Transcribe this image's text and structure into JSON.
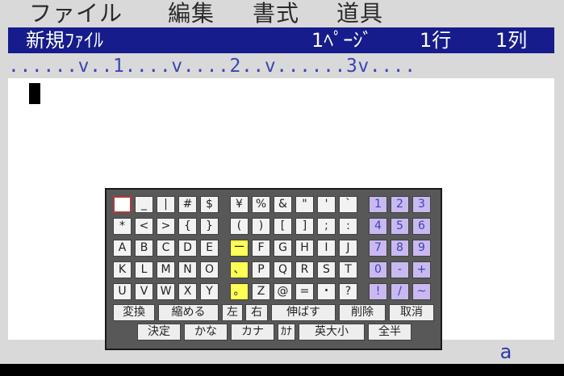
{
  "menu": {
    "file": "ファイル",
    "edit": "編集",
    "format": "書式",
    "tools": "道具"
  },
  "status": {
    "document_name": "新規ﾌｧｲﾙ",
    "page": "1ﾍﾟｰｼﾞ",
    "line": "1行",
    "column": "1列"
  },
  "ruler": "......v..1....v....2..v......3v....",
  "mode_indicator": "a",
  "keyboard": {
    "rows": [
      [
        " ",
        "_",
        "|",
        "#",
        "$",
        "¥",
        "%",
        "&",
        "\"",
        "'",
        "`",
        "1",
        "2",
        "3"
      ],
      [
        "*",
        "<",
        ">",
        "{",
        "}",
        "(",
        ")",
        "[",
        "]",
        ";",
        ":",
        "4",
        "5",
        "6"
      ],
      [
        "A",
        "B",
        "C",
        "D",
        "E",
        "ー",
        "F",
        "G",
        "H",
        "I",
        "J",
        "7",
        "8",
        "9"
      ],
      [
        "K",
        "L",
        "M",
        "N",
        "O",
        "、",
        "P",
        "Q",
        "R",
        "S",
        "T",
        "0",
        "-",
        "+"
      ],
      [
        "U",
        "V",
        "W",
        "X",
        "Y",
        "。",
        "Z",
        "@",
        "=",
        "・",
        "?",
        "!",
        "/",
        "~"
      ]
    ],
    "function_row_1": [
      "変換",
      "縮める",
      "左",
      "右",
      "伸ばす",
      "削除",
      "取消"
    ],
    "function_row_2": [
      "決定",
      "かな",
      "カナ",
      "ｶﾅ",
      "英大小",
      "全半"
    ]
  },
  "colors": {
    "title_bar": "#161c8c",
    "ruler_text": "#3a44b8",
    "numeric_keys": "#c9b9f0",
    "punctuation_keys": "#ffff55",
    "keyboard_panel": "#585858"
  }
}
